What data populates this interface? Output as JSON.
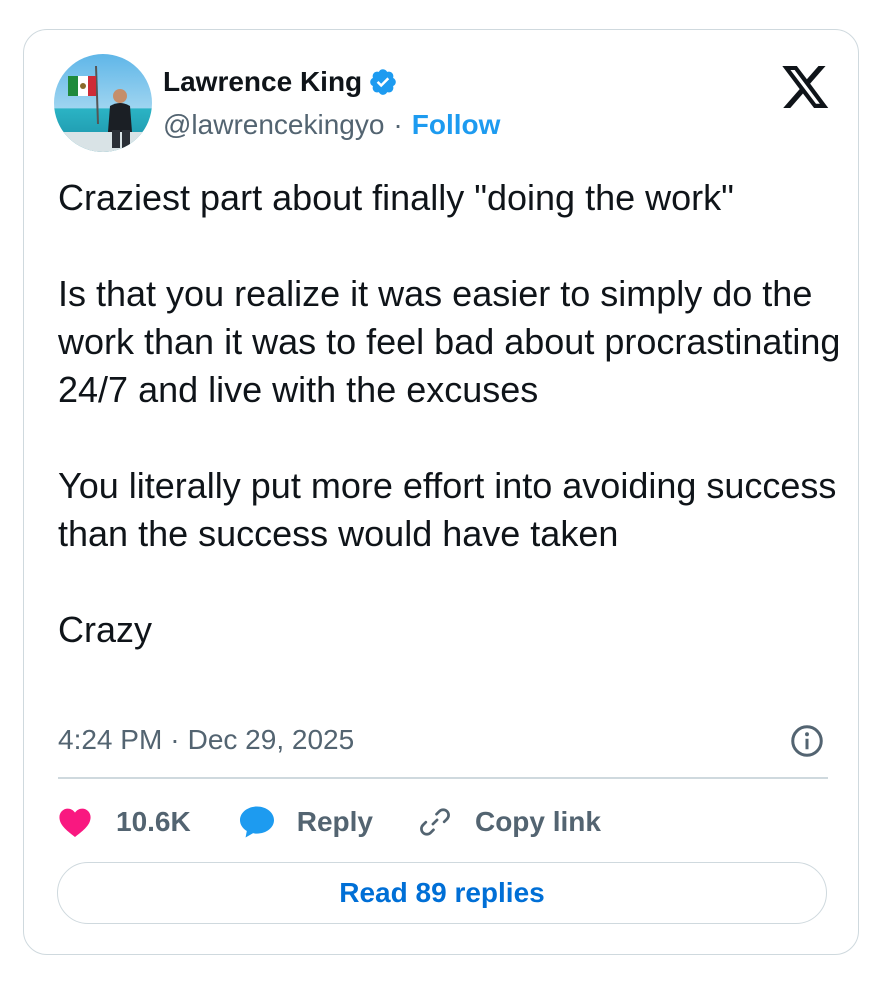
{
  "author": {
    "name": "Lawrence King",
    "handle": "@lawrencekingyo",
    "separator": "·",
    "follow_label": "Follow",
    "verified": true,
    "avatar_icon": "profile-photo"
  },
  "brand": {
    "logo_icon": "x-logo-icon"
  },
  "tweet": {
    "paragraphs": [
      "Craziest part about finally \"doing the work\"",
      "Is that you realize it was easier to simply do the work than it was to feel bad about procrastinating 24/7 and live with the excuses",
      "You literally put more effort into avoiding success than the success would have taken",
      "Crazy"
    ],
    "time": "4:24 PM",
    "date_separator": "·",
    "date": "Dec 29, 2025"
  },
  "actions": {
    "like_count": "10.6K",
    "reply_label": "Reply",
    "copy_label": "Copy link"
  },
  "read_replies_label": "Read 89 replies",
  "colors": {
    "accent": "#1d9bf0",
    "link": "#006fd6",
    "like": "#f91880",
    "text": "#0f1419",
    "muted": "#536471",
    "border": "#cfd9de"
  }
}
